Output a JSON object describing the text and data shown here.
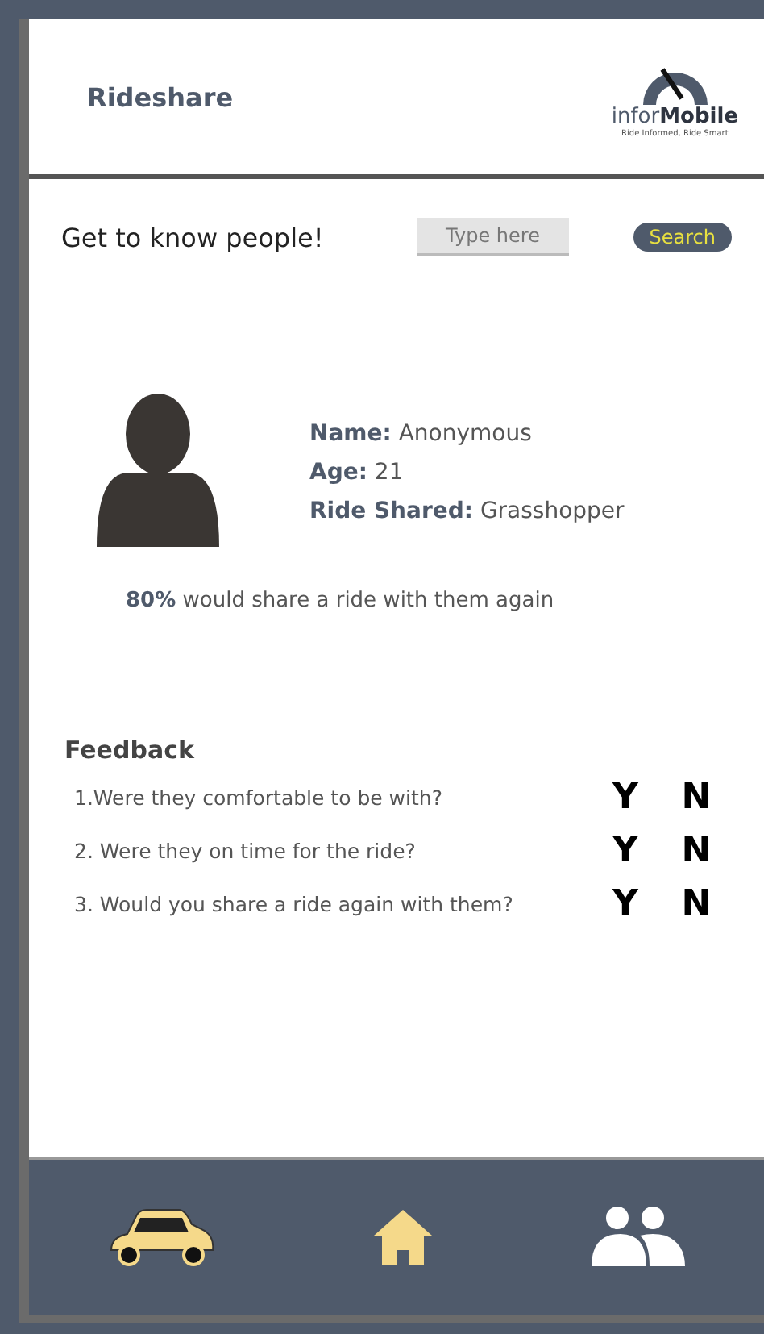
{
  "header": {
    "title": "Rideshare",
    "logo": {
      "brand_light": "infor",
      "brand_bold": "Mobile",
      "tagline": "Ride Informed, Ride Smart"
    }
  },
  "search": {
    "heading": "Get to know people!",
    "placeholder": "Type here",
    "button": "Search"
  },
  "profile": {
    "fields": [
      {
        "label": "Name:",
        "value": "Anonymous"
      },
      {
        "label": "Age:",
        "value": "21"
      },
      {
        "label": "Ride Shared:",
        "value": "Grasshopper"
      }
    ],
    "summary": "**80%** would share a ride with them again"
  },
  "feedback": {
    "title": "Feedback",
    "questions": [
      {
        "text": "1.Were they comfortable to be with?",
        "yes": "Y",
        "no": "N"
      },
      {
        "text": "2. Were they on time for the ride?",
        "yes": "Y",
        "no": "N"
      },
      {
        "text": "3. Would you share a ride again with them?",
        "yes": "Y",
        "no": "N"
      }
    ]
  },
  "nav": [
    {
      "kind": "car"
    },
    {
      "kind": "home"
    },
    {
      "kind": "people"
    }
  ]
}
